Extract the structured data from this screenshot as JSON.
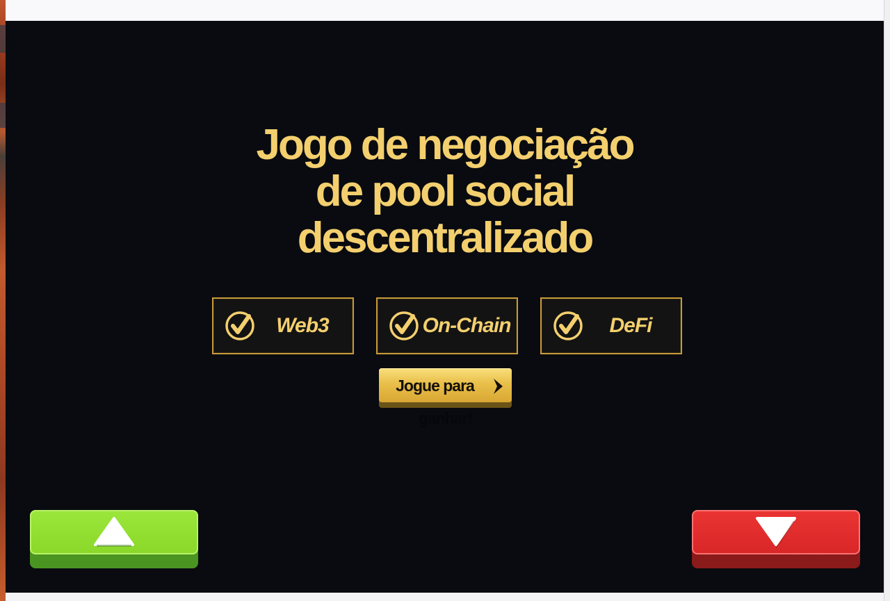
{
  "headline": {
    "lines": [
      "Jogo de negociação",
      "de pool social",
      "descentralizado"
    ]
  },
  "features": [
    {
      "label": "Web3",
      "icon": "check-circle-icon"
    },
    {
      "label": "On-Chain",
      "icon": "check-circle-icon"
    },
    {
      "label": "DeFi",
      "icon": "check-circle-icon"
    }
  ],
  "cta": {
    "label_line1": "Jogue para",
    "label_line2": "ganhar!",
    "icon": "chevron-right-icon"
  },
  "controls": {
    "up": {
      "icon": "triangle-up-icon",
      "color": "#8ad82a"
    },
    "down": {
      "icon": "triangle-down-icon",
      "color": "#d92626"
    }
  },
  "colors": {
    "background": "#090b10",
    "gold": "#f3cf6e",
    "border_gold": "#c79a3a"
  }
}
